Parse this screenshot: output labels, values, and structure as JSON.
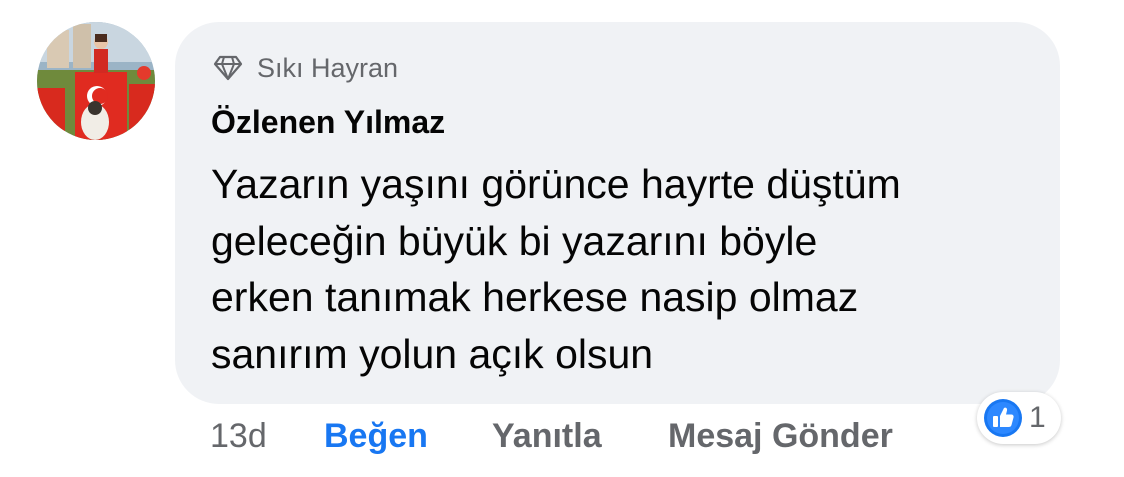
{
  "comment": {
    "badge": {
      "icon": "diamond-icon",
      "label": "Sıkı Hayran"
    },
    "author": "Özlenen Yılmaz",
    "text_lines": [
      "Yazarın yaşını görünce hayrte düştüm",
      "geleceğin büyük bi yazarını böyle",
      "erken tanımak herkese nasip olmaz",
      "sanırım yolun açık olsun"
    ]
  },
  "actions": {
    "time": "13d",
    "like_label": "Beğen",
    "reply_label": "Yanıtla",
    "message_label": "Mesaj Gönder"
  },
  "reactions": {
    "icon": "thumbs-up-icon",
    "count": "1"
  },
  "colors": {
    "bubble_bg": "#f0f2f5",
    "like_blue": "#1877f2",
    "secondary_text": "#65676b",
    "primary_text": "#050505"
  }
}
